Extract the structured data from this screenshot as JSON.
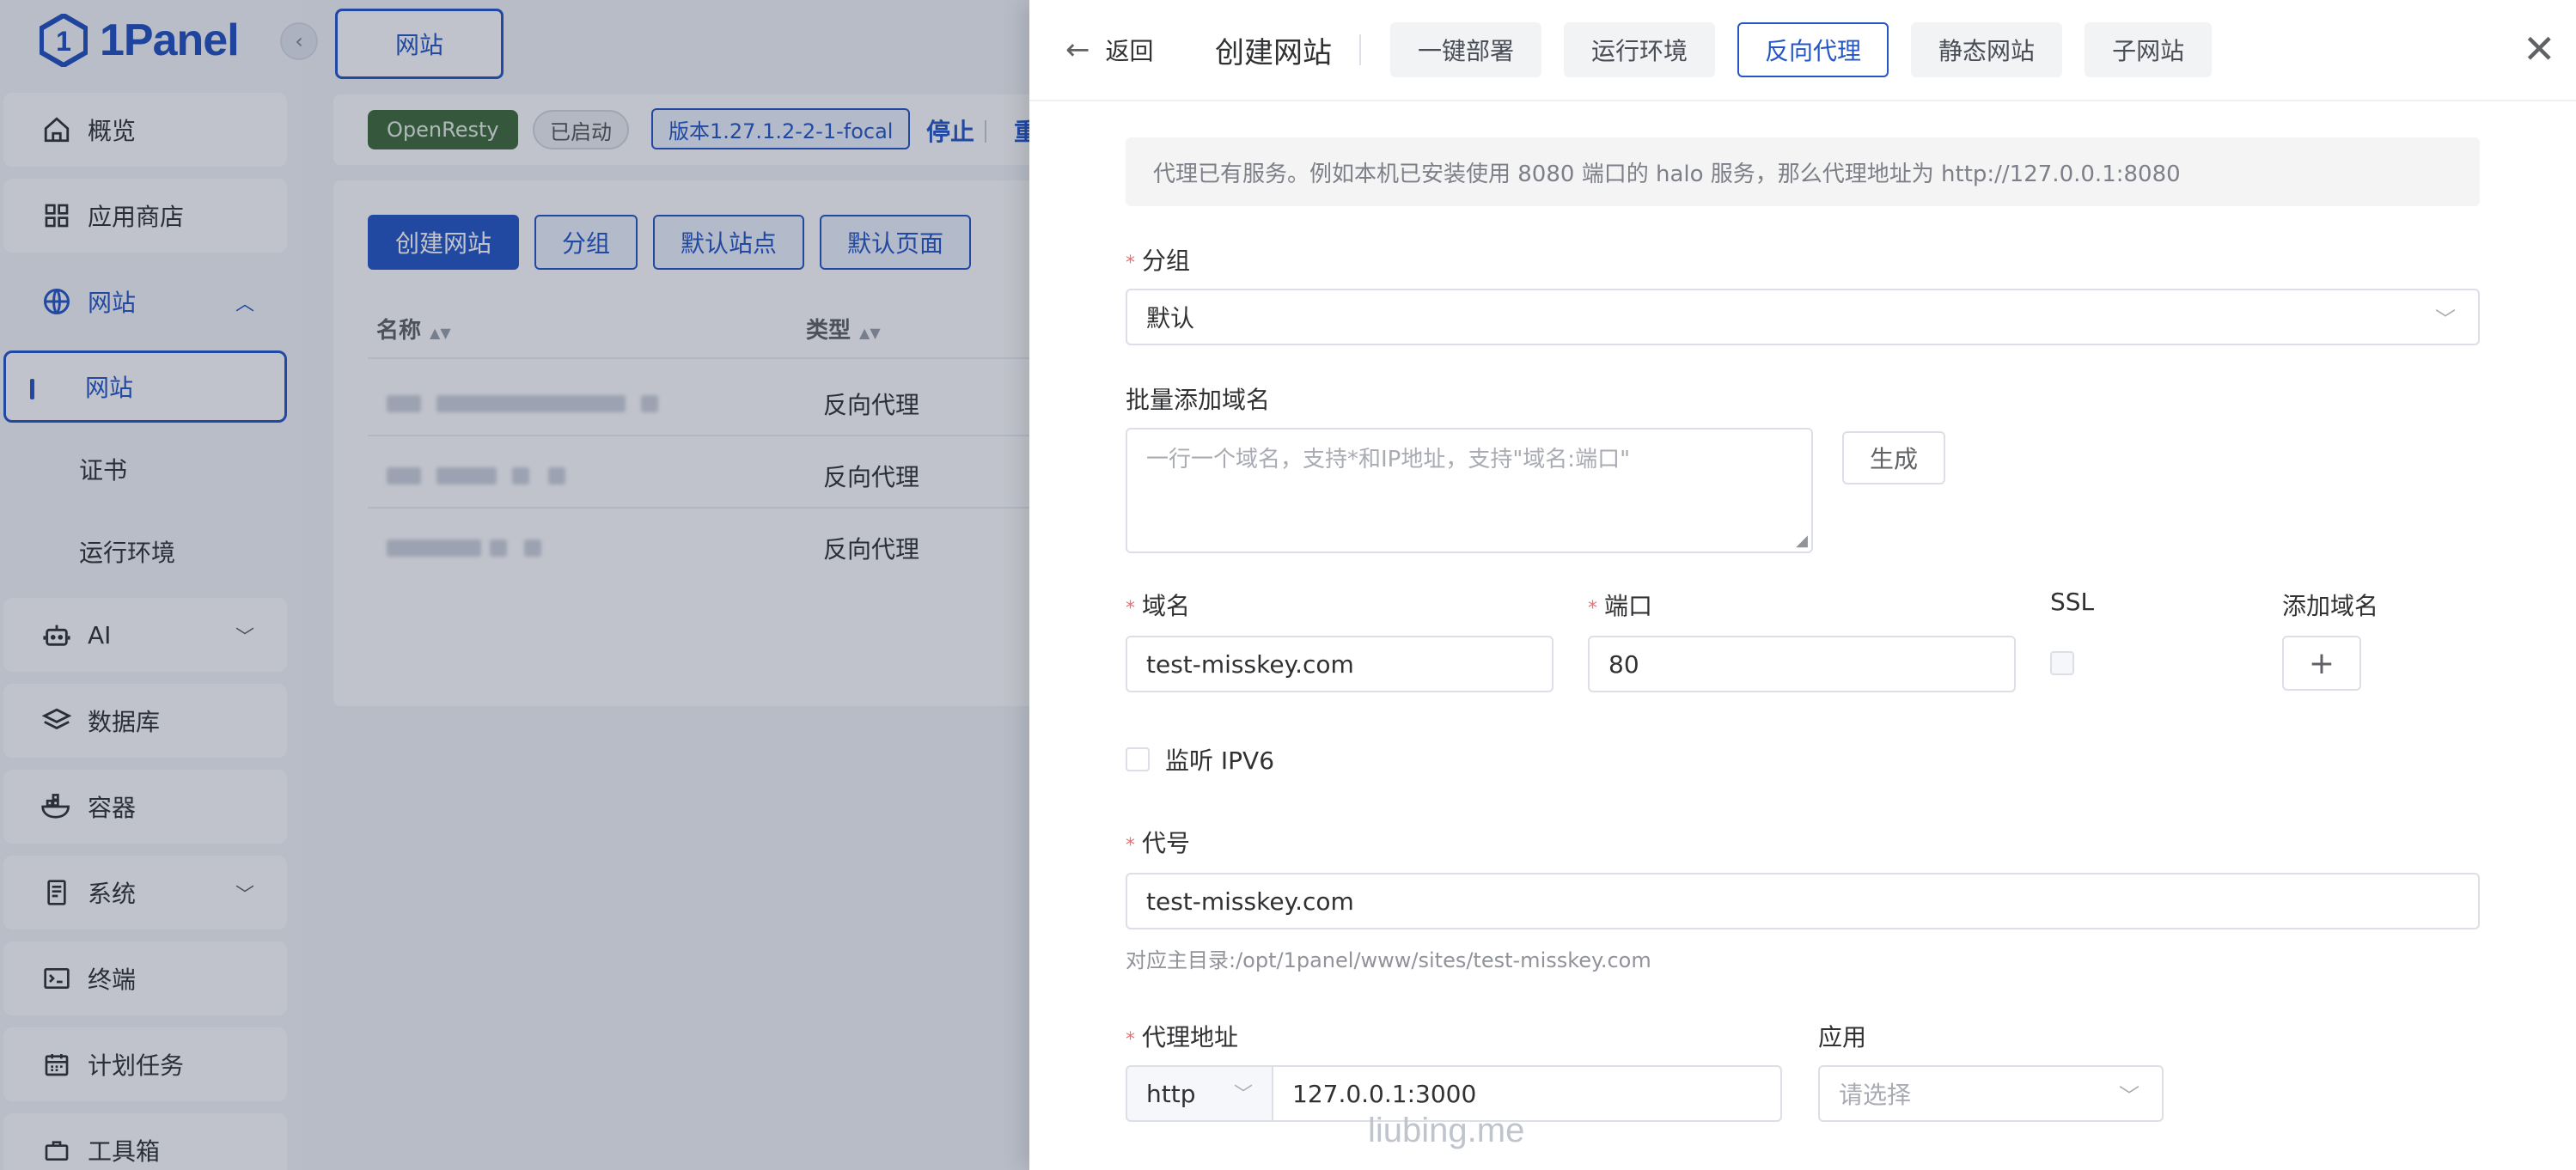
{
  "app": {
    "logo_text": "1Panel"
  },
  "sidebar": {
    "items": [
      {
        "label": "概览",
        "icon": "home-icon"
      },
      {
        "label": "应用商店",
        "icon": "grid-icon"
      },
      {
        "label": "网站",
        "icon": "globe-icon",
        "expanded": true
      },
      {
        "label": "网站",
        "sub": true,
        "active": true
      },
      {
        "label": "证书",
        "sub": true
      },
      {
        "label": "运行环境",
        "sub": true
      },
      {
        "label": "AI",
        "icon": "robot-icon"
      },
      {
        "label": "数据库",
        "icon": "layers-icon"
      },
      {
        "label": "容器",
        "icon": "docker-icon"
      },
      {
        "label": "系统",
        "icon": "server-icon"
      },
      {
        "label": "终端",
        "icon": "terminal-icon"
      },
      {
        "label": "计划任务",
        "icon": "calendar-icon"
      },
      {
        "label": "工具箱",
        "icon": "toolbox-icon"
      }
    ]
  },
  "topbar": {
    "tab_label": "网站"
  },
  "status": {
    "service": "OpenResty",
    "state": "已启动",
    "version": "版本1.27.1.2-2-1-focal",
    "stop": "停止",
    "restart": "重"
  },
  "toolbar": {
    "create": "创建网站",
    "group": "分组",
    "default_site": "默认站点",
    "default_page": "默认页面"
  },
  "table": {
    "columns": [
      "名称",
      "类型"
    ],
    "rows": [
      {
        "type": "反向代理"
      },
      {
        "type": "反向代理"
      },
      {
        "type": "反向代理"
      }
    ]
  },
  "drawer": {
    "back": "返回",
    "title": "创建网站",
    "tabs": [
      "一键部署",
      "运行环境",
      "反向代理",
      "静态网站",
      "子网站"
    ],
    "active_tab": "反向代理",
    "tip": "代理已有服务。例如本机已安装使用 8080 端口的 halo 服务，那么代理地址为 http://127.0.0.1:8080",
    "form": {
      "group_label": "分组",
      "group_value": "默认",
      "batch_label": "批量添加域名",
      "batch_placeholder": "一行一个域名，支持*和IP地址，支持\"域名:端口\"",
      "generate": "生成",
      "domain_label": "域名",
      "domain_value": "test-misskey.com",
      "port_label": "端口",
      "port_value": "80",
      "ssl_label": "SSL",
      "add_domain_label": "添加域名",
      "ipv6_label": "监听 IPV6",
      "alias_label": "代号",
      "alias_value": "test-misskey.com",
      "alias_hint": "对应主目录:/opt/1panel/www/sites/test-misskey.com",
      "proxy_label": "代理地址",
      "proxy_protocol": "http",
      "proxy_value": "127.0.0.1:3000",
      "app_label": "应用",
      "app_placeholder": "请选择"
    }
  },
  "watermark": "liubing.me",
  "colors": {
    "accent": "#2456c5",
    "required": "#f56c6c"
  }
}
